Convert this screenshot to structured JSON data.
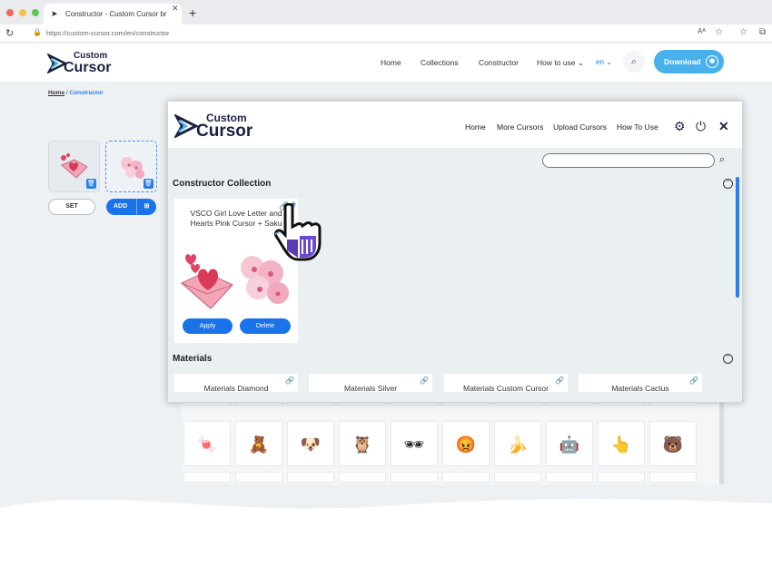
{
  "browser": {
    "tab_title": "Constructor - Custom Cursor br",
    "url": "https://custom-cursor.com/en/constructor",
    "dot_colors": [
      "#ed6a5e",
      "#f5bf4f",
      "#61c554"
    ]
  },
  "site": {
    "logo_top": "Custom",
    "logo_bottom": "Cursor",
    "nav": [
      "Home",
      "Collections",
      "Constructor",
      "How to use"
    ],
    "lang": "en",
    "download_label": "Download"
  },
  "breadcrumb": {
    "home": "Home",
    "sep": "/",
    "current": "Constructor"
  },
  "left_panel": {
    "set_label": "SET",
    "add_label": "ADD"
  },
  "popup": {
    "logo_top": "Custom",
    "logo_bottom": "Cursor",
    "nav": [
      "Home",
      "More Cursors",
      "Upload Cursors",
      "How To Use"
    ],
    "icons": [
      "gear-icon",
      "power-icon",
      "close-icon"
    ],
    "search_placeholder": "",
    "constructor_title": "Constructor Collection",
    "card": {
      "title": "VSCO Girl Love Letter and Hearts Pink Cursor + Saku",
      "apply_label": "Apply",
      "delete_label": "Delete"
    },
    "materials_title": "Materials",
    "materials": [
      "Materials Diamond",
      "Materials Silver",
      "Materials Custom Cursor",
      "Materials Cactus"
    ]
  },
  "grid_icons": [
    "🍬",
    "🧸",
    "🐶",
    "🦉",
    "🕶",
    "😡",
    "🍌",
    "🤖",
    "👆",
    "🐻"
  ],
  "colors": {
    "accent": "#1a73e8",
    "download": "#4ab0ec",
    "navy": "#1a2242"
  }
}
